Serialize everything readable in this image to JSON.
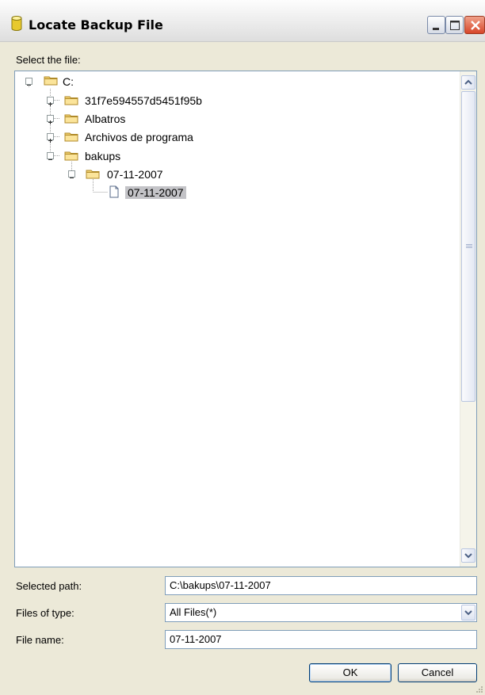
{
  "window": {
    "title": "Locate Backup File"
  },
  "tree": {
    "label": "Select the file:",
    "nodes": [
      {
        "label": "C:"
      },
      {
        "label": "31f7e594557d5451f95b"
      },
      {
        "label": "Albatros"
      },
      {
        "label": "Archivos de programa"
      },
      {
        "label": "bakups"
      },
      {
        "label": "07-11-2007"
      },
      {
        "label": "07-11-2007"
      }
    ]
  },
  "form": {
    "selected_path_label": "Selected path:",
    "selected_path_value": "C:\\bakups\\07-11-2007",
    "files_of_type_label": "Files of type:",
    "files_of_type_value": "All Files(*)",
    "file_name_label": "File name:",
    "file_name_value": "07-11-2007"
  },
  "buttons": {
    "ok": "OK",
    "cancel": "Cancel"
  }
}
